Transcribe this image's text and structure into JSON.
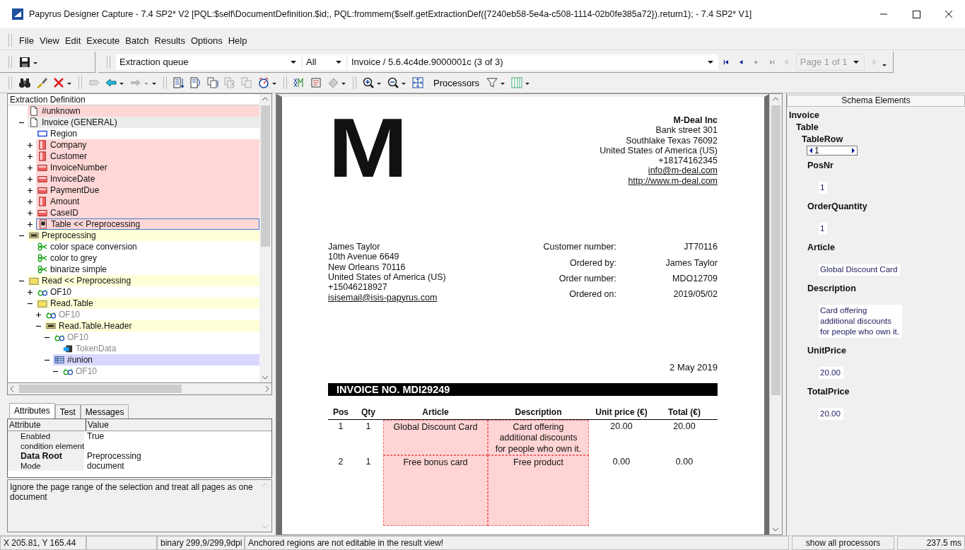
{
  "window": {
    "title": "Papyrus Designer Capture - 7.4 SP2* V2 [PQL:$self\\DocumentDefinition.$id;, PQL:frommem($self.getExtractionDef({7240eb58-5e4a-c508-1114-02b0fe385a72}).return1); - 7.4 SP2* V1]"
  },
  "menu": [
    "File",
    "View",
    "Edit",
    "Execute",
    "Batch",
    "Results",
    "Options",
    "Help"
  ],
  "toolbar": {
    "queue": "Extraction queue",
    "filter": "All",
    "document": "Invoice / 5.6.4c4de.9000001c (3 of 3)",
    "nav": [
      {
        "kind": "first",
        "disabled": false
      },
      {
        "kind": "prev",
        "disabled": false
      },
      {
        "kind": "next",
        "disabled": true
      },
      {
        "kind": "last",
        "disabled": true
      }
    ],
    "page": {
      "label": "Page 1 of 1",
      "disabled": true
    },
    "processors": "Processors"
  },
  "left": {
    "tree_header": "Extraction Definition",
    "tree": [
      {
        "label": "#unknown",
        "kind": "doc",
        "color": "#ffd7d7",
        "selected": false,
        "disabled": false
      },
      {
        "label": "Invoice (GENERAL)",
        "kind": "doc",
        "color": "#ececec",
        "selected": false,
        "disabled": false,
        "expanded": true,
        "children": [
          {
            "label": "Region",
            "kind": "region",
            "selected": false,
            "disabled": false
          },
          {
            "label": "Company",
            "kind": "field-v",
            "color": "#ffd7d7",
            "selected": false,
            "disabled": false,
            "expanded": false
          },
          {
            "label": "Customer",
            "kind": "field-v",
            "color": "#ffd7d7",
            "selected": false,
            "disabled": false,
            "expanded": false
          },
          {
            "label": "InvoiceNumber",
            "kind": "field-h",
            "color": "#ffd7d7",
            "selected": false,
            "disabled": false,
            "expanded": false
          },
          {
            "label": "InvoiceDate",
            "kind": "field-h",
            "color": "#ffd7d7",
            "selected": false,
            "disabled": false,
            "expanded": false
          },
          {
            "label": "PaymentDue",
            "kind": "field-h",
            "color": "#ffd7d7",
            "selected": false,
            "disabled": false,
            "expanded": false
          },
          {
            "label": "Amount",
            "kind": "field-v",
            "color": "#ffd7d7",
            "selected": false,
            "disabled": false,
            "expanded": false
          },
          {
            "label": "CaseID",
            "kind": "field-h",
            "color": "#ffd7d7",
            "selected": false,
            "disabled": false,
            "expanded": false
          },
          {
            "label": "Table << Preprocessing",
            "kind": "table",
            "color": "#ffd7d7",
            "selected": true,
            "disabled": false,
            "expanded": false
          }
        ]
      },
      {
        "label": "Preprocessing",
        "kind": "caf",
        "color": "#ffffd8",
        "selected": false,
        "disabled": false,
        "expanded": true,
        "children": [
          {
            "label": "color space conversion",
            "kind": "scissors",
            "selected": false,
            "disabled": false
          },
          {
            "label": "color to grey",
            "kind": "scissors",
            "selected": false,
            "disabled": false
          },
          {
            "label": "binarize simple",
            "kind": "scissors",
            "selected": false,
            "disabled": false
          }
        ]
      },
      {
        "label": "Read << Preprocessing",
        "kind": "folder",
        "color": "#ffffd8",
        "selected": false,
        "disabled": false,
        "expanded": true,
        "children": [
          {
            "label": "OF10",
            "kind": "glasses",
            "selected": false,
            "disabled": false,
            "expanded": false
          },
          {
            "label": "Read.Table",
            "kind": "folder",
            "color": "#ffffd8",
            "selected": false,
            "disabled": false,
            "expanded": true,
            "children": [
              {
                "label": "OF10",
                "kind": "glasses",
                "selected": false,
                "disabled": true,
                "expanded": false
              },
              {
                "label": "Read.Table.Header",
                "kind": "caf",
                "color": "#ffffd8",
                "selected": false,
                "disabled": false,
                "expanded": true,
                "children": [
                  {
                    "label": "OF10",
                    "kind": "glasses",
                    "selected": false,
                    "disabled": true,
                    "expanded": true,
                    "children": [
                      {
                        "label": "TokenData",
                        "kind": "token",
                        "selected": false,
                        "disabled": true
                      }
                    ]
                  },
                  {
                    "label": "#union",
                    "kind": "union",
                    "color": "#d8d8ff",
                    "selected": false,
                    "disabled": false,
                    "expanded": true,
                    "children": [
                      {
                        "label": "OF10",
                        "kind": "glasses",
                        "selected": false,
                        "disabled": true,
                        "expanded": true
                      }
                    ]
                  }
                ]
              }
            ]
          }
        ]
      }
    ],
    "tabs": [
      {
        "label": "Attributes",
        "selected": true
      },
      {
        "label": "Test",
        "selected": false
      },
      {
        "label": "Messages",
        "selected": false
      }
    ],
    "attributes": {
      "columns": [
        "Attribute",
        "Value"
      ],
      "rows": [
        {
          "attribute": "Enabled",
          "value": "True",
          "bold": false
        },
        {
          "attribute": "condition element",
          "bold": false
        },
        {
          "attribute": "Data Root",
          "value": "Preprocessing",
          "bold": true
        },
        {
          "attribute": "Mode",
          "value": "document",
          "bold": false
        }
      ]
    },
    "description": "Ignore the page range of the selection and treat all pages as one document"
  },
  "document": {
    "logo": "M",
    "company": [
      "M-Deal Inc",
      "Bank street 301",
      "Southlake Texas 76092",
      "United States of America (US)",
      "+18174162345"
    ],
    "company_links": [
      "info@m-deal.com",
      "http://www.m-deal.com"
    ],
    "customer": [
      "James Taylor",
      "10th Avenue  6649",
      "New Orleans  70116",
      "United States of America (US)",
      "+15046218927"
    ],
    "customer_link": "isisemail@isis-papyrus.com",
    "order_info": [
      {
        "label": "Customer number:",
        "value": "JT70116"
      },
      {
        "label": "Ordered by:",
        "value": "James Taylor"
      },
      {
        "label": "Order number:",
        "value": "MDO12709"
      },
      {
        "label": "Ordered on:",
        "value": "2019/05/02"
      }
    ],
    "date": "2 May 2019",
    "invoice_title": "INVOICE NO. MDI29249",
    "table": {
      "columns": [
        {
          "label": "Pos",
          "highlighted": false
        },
        {
          "label": "Qty",
          "highlighted": false
        },
        {
          "label": "Article",
          "highlighted": true
        },
        {
          "label": "Description",
          "highlighted": true
        },
        {
          "label": "Unit price (€)",
          "highlighted": false
        },
        {
          "label": "Total (€)",
          "highlighted": false
        }
      ],
      "rows": [
        [
          "1",
          "1",
          "Global Discount Card",
          "Card offering\nadditional discounts\nfor people who own it.",
          "20.00",
          "20.00"
        ],
        [
          "2",
          "1",
          "Free bonus card",
          "Free product",
          "0.00",
          "0.00"
        ]
      ]
    }
  },
  "schema": {
    "header": "Schema Elements",
    "root": "Invoice",
    "table": "Table",
    "row": "TableRow",
    "row_index": "1",
    "fields": [
      {
        "label": "PosNr",
        "value": "1"
      },
      {
        "label": "OrderQuantity",
        "value": "1"
      },
      {
        "label": "Article",
        "value": "Global Discount Card"
      },
      {
        "label": "Description",
        "value": "Card offering\nadditional discounts\nfor people who own it."
      },
      {
        "label": "UnitPrice",
        "value": "20.00"
      },
      {
        "label": "TotalPrice",
        "value": "20.00"
      }
    ]
  },
  "status_bar": [
    "X 205.81, Y 165.44",
    "binary 299,9/299,9dpi",
    "Anchored regions are not editable in the result view!",
    "show all processors",
    "237.5 ms"
  ]
}
